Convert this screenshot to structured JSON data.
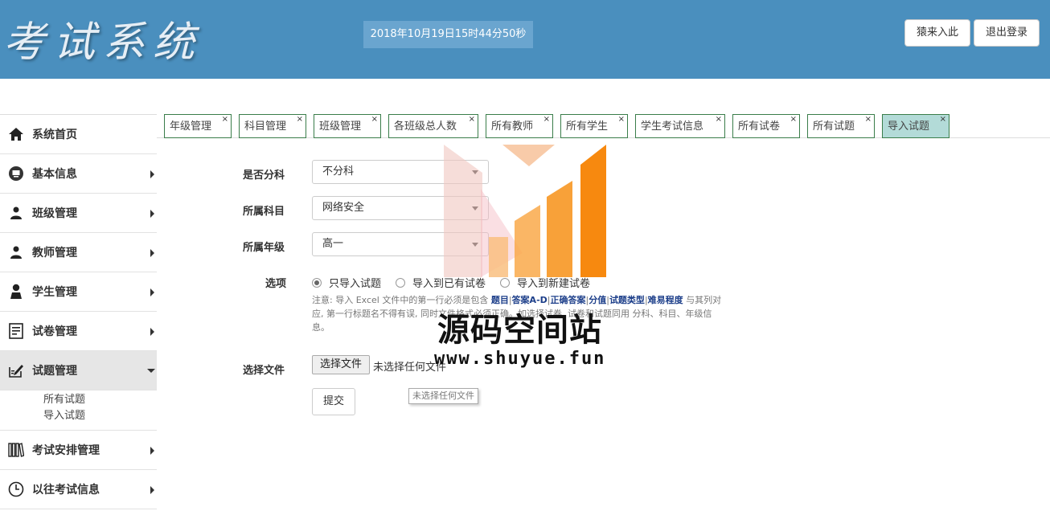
{
  "header": {
    "logo_text": "考试系统",
    "clock": "2018年10月19日15时44分50秒",
    "buttons": {
      "enter": "猿来入此",
      "logout": "退出登录"
    }
  },
  "sidebar": {
    "items": [
      {
        "label": "系统首页",
        "icon": "home-icon"
      },
      {
        "label": "基本信息",
        "icon": "monitor-icon"
      },
      {
        "label": "班级管理",
        "icon": "users-icon"
      },
      {
        "label": "教师管理",
        "icon": "users-icon"
      },
      {
        "label": "学生管理",
        "icon": "user-icon"
      },
      {
        "label": "试卷管理",
        "icon": "list-icon"
      },
      {
        "label": "试题管理",
        "icon": "edit-icon"
      },
      {
        "label": "考试安排管理",
        "icon": "books-icon"
      },
      {
        "label": "以往考试信息",
        "icon": "clock-icon"
      }
    ],
    "subitems": [
      "所有试题",
      "导入试题"
    ]
  },
  "tabs": [
    {
      "label": "年级管理"
    },
    {
      "label": "科目管理"
    },
    {
      "label": "班级管理"
    },
    {
      "label": "各班级总人数"
    },
    {
      "label": "所有教师"
    },
    {
      "label": "所有学生"
    },
    {
      "label": "学生考试信息"
    },
    {
      "label": "所有试卷"
    },
    {
      "label": "所有试题"
    },
    {
      "label": "导入试题"
    }
  ],
  "tab_close": "×",
  "form": {
    "division_label": "是否分科",
    "division_value": "不分科",
    "subject_label": "所属科目",
    "subject_value": "网络安全",
    "grade_label": "所属年级",
    "grade_value": "高一",
    "options_label": "选项",
    "options": [
      "只导入试题",
      "导入到已有试卷",
      "导入到新建试卷"
    ],
    "selected_option": "只导入试题",
    "note_prefix": "注意: 导入 Excel 文件中的第一行必须是包含 ",
    "note_fields": [
      "题目",
      "答案A-D",
      "正确答案",
      "分值",
      "试题类型",
      "难易程度"
    ],
    "note_suffix": " 与其列对应, 第一行标题名不得有误, 同时文件格式必须正确。如选择试卷, 试卷和试题同用 分科、科目、年级信息。",
    "file_label": "选择文件",
    "file_button": "选择文件",
    "file_status": "未选择任何文件",
    "file_tooltip": "未选择任何文件",
    "submit": "提交"
  },
  "watermark": {
    "title": "源码空间站",
    "url": "www.shuyue.fun"
  },
  "colors": {
    "header_bg": "#4a8fbe",
    "tab_border": "#3a7d4a",
    "tab_active_bg": "#b3dbd8",
    "note_highlight": "#1d3f8a",
    "watermark_orange": "#f7890f"
  }
}
